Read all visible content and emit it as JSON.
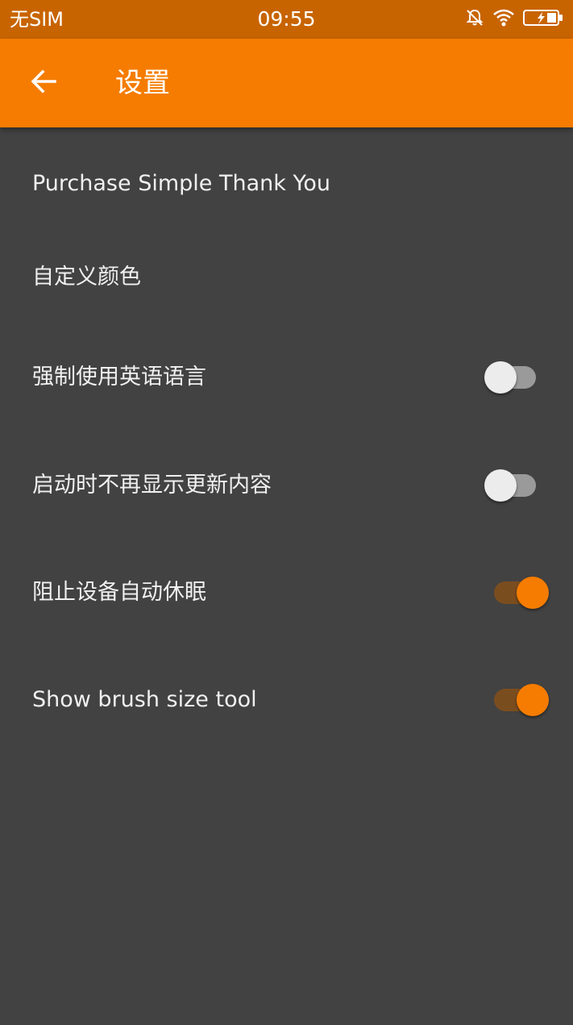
{
  "status_bar": {
    "carrier": "无SIM",
    "time": "09:55",
    "icons": [
      "bell-off-icon",
      "wifi-icon",
      "battery-charging-icon"
    ]
  },
  "app_bar": {
    "title": "设置",
    "back_icon": "arrow-left-icon"
  },
  "settings": [
    {
      "label": "Purchase Simple Thank You",
      "has_switch": false
    },
    {
      "label": "自定义颜色",
      "has_switch": false
    },
    {
      "label": "强制使用英语语言",
      "has_switch": true,
      "checked": false
    },
    {
      "label": "启动时不再显示更新内容",
      "has_switch": true,
      "checked": false
    },
    {
      "label": "阻止设备自动休眠",
      "has_switch": true,
      "checked": true
    },
    {
      "label": "Show brush size tool",
      "has_switch": true,
      "checked": true
    }
  ],
  "colors": {
    "status_bar": "#c86400",
    "app_bar": "#f57c00",
    "background": "#424242",
    "accent": "#f57c00",
    "text": "#f0f0f0"
  }
}
